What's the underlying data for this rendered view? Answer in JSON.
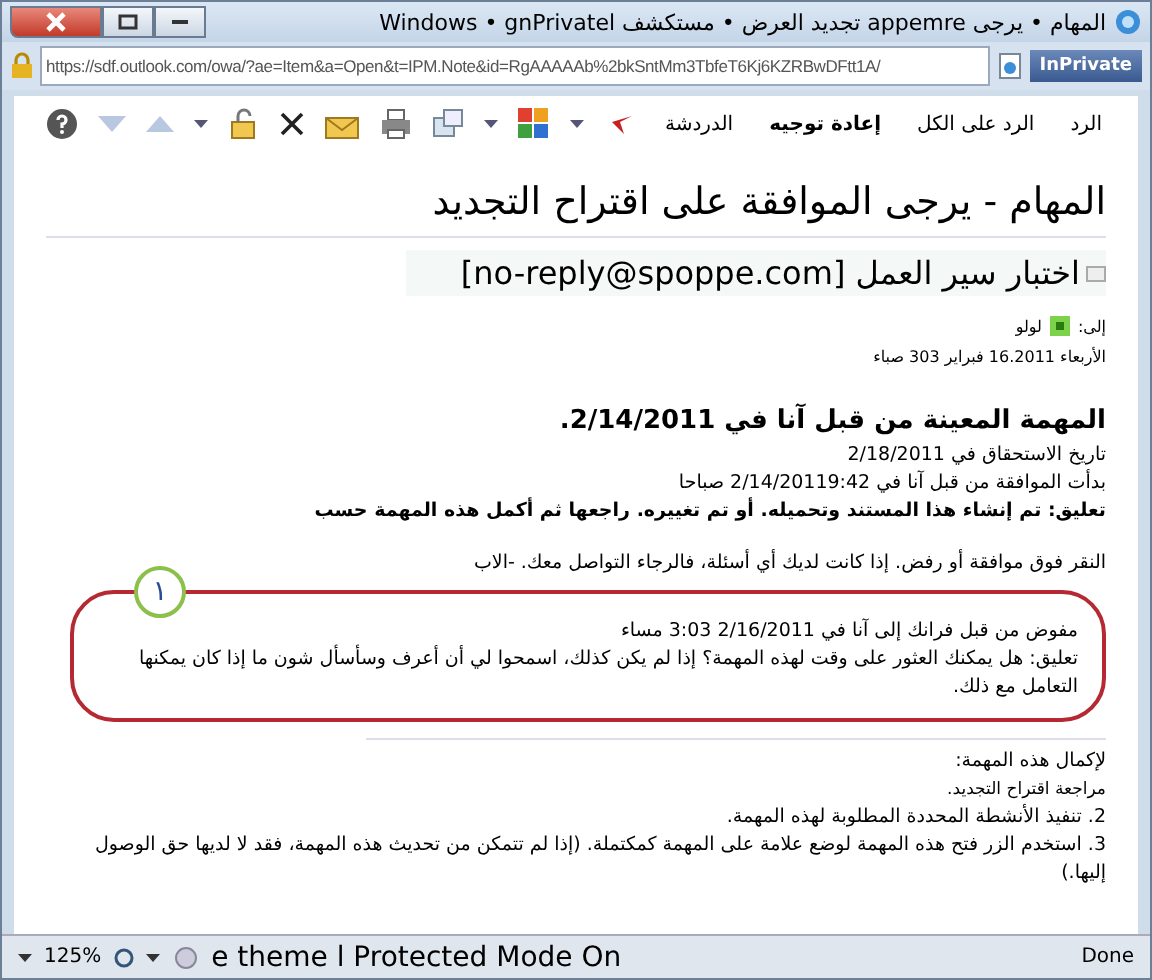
{
  "window": {
    "title": "المهام • يرجى appemre تجديد العرض • مستكشف Windows • gnPrivatel"
  },
  "address_bar": {
    "badge": "InPrivate",
    "url": "https://sdf.outlook.com/owa/?ae=Item&a=Open&t=IPM.Note&id=RgAAAAAb%2bkSntMm3TbfeT6Kj6KZRBwDFtt1A/"
  },
  "toolbar": {
    "buttons": [
      {
        "label": "الرد",
        "kind": "text"
      },
      {
        "label": "الرد على الكل",
        "kind": "text"
      },
      {
        "label": "إعادة توجيه",
        "kind": "bold"
      },
      {
        "label": "الدردشة",
        "kind": "text"
      }
    ]
  },
  "message": {
    "subject": "المهام - يرجى الموافقة على اقتراح التجديد",
    "from": "اختبار سير العمل [no-reply@spoppe.com]",
    "to_label": "إلى:",
    "to_name": "لولو",
    "date": "الأربعاء 16.2011 فبراير 303 صباء"
  },
  "body": {
    "heading": "المهمة المعينة من قبل آنا في 2/14/2011.",
    "due": "تاريخ الاستحقاق في 2/18/2011",
    "started": "بدأت الموافقة من قبل آنا في 2/14/20119:42 صباحا",
    "comment": "تعليق: تم إنشاء هذا المستند وتحميله. أو تم تغييره. راجعها ثم أكمل هذه المهمة حسب",
    "instruction": "النقر فوق موافقة أو رفض. إذا كانت لديك أي أسئلة، فالرجاء التواصل معك. -الاب",
    "callout": {
      "number": "١",
      "delegated": "مفوض من قبل فرانك إلى آنا في 2/16/2011 3:03 مساء",
      "comment": "تعليق: هل يمكنك العثور على وقت لهذه المهمة؟ إذا لم يكن كذلك، اسمحوا لي أن أعرف وسأسأل شون ما إذا كان يمكنها التعامل مع ذلك."
    },
    "steps_heading": "لإكمال هذه المهمة:",
    "steps": [
      "مراجعة اقتراح التجديد.",
      "2. تنفيذ الأنشطة المحددة المطلوبة لهذه المهمة.",
      "3. استخدم الزر فتح هذه المهمة لوضع علامة على المهمة كمكتملة. (إذا لم تتمكن من تحديث هذه المهمة، فقد لا لديها حق الوصول إليها.)"
    ]
  },
  "status_bar": {
    "state": "Done",
    "mode": "e theme l Protected Mode On",
    "zoom": "125%"
  }
}
